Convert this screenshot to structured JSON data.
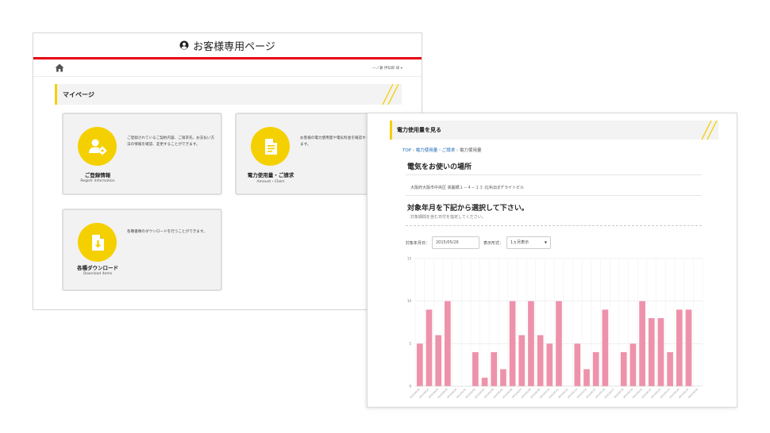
{
  "back_window": {
    "header_title": "お客様専用ページ",
    "user_menu": "一ノ瀬 伊知郎 様 ▾",
    "section_title": "マイページ",
    "cards": [
      {
        "title": "ご登録情報",
        "subtitle": "Registr Information",
        "description": "ご登録されているご契約内容、ご請求先、お支払い方法の情報を確認、変更することができます。",
        "icon": "user-gear-icon"
      },
      {
        "title": "電力使用量・ご請求",
        "subtitle": "Amount・Claim",
        "description": "お客様の電力使用量や電気料金を確認することができます。",
        "icon": "document-icon"
      },
      {
        "title": "各種ダウンロード",
        "subtitle": "Download items",
        "description": "各種書類のダウンロードを行うことができます。",
        "icon": "download-file-icon"
      }
    ]
  },
  "front_window": {
    "section_title": "電力使用量を見る",
    "breadcrumb": [
      "TOP",
      "電力使用量・ご請求",
      "電力使用量"
    ],
    "breadcrumb_sep": "›",
    "place_heading": "電気をお使いの場所",
    "address": "大阪府大阪市中央区 高麗橋１－４－１３ 北浜ほぼデライトビル",
    "period_heading": "対象年月を下記から選択して下さい。",
    "period_note": "対象期間を含む日付を指定してください。",
    "filter": {
      "date_label": "対象年月日：",
      "date_value": "2015/05/26",
      "display_label": "表示形式：",
      "display_value": "1ヵ月表示"
    }
  },
  "colors": {
    "accent_yellow": "#f5d000",
    "header_red": "#e60012",
    "bar_pink": "#ee92ab"
  },
  "chart_data": {
    "type": "bar",
    "title": "",
    "xlabel": "",
    "ylabel": "",
    "ylim": [
      0,
      15
    ],
    "yticks": [
      "0",
      "5",
      "10",
      "15"
    ],
    "grid": true,
    "categories": [
      "2015/04/26",
      "2015/04/27",
      "2015/04/28",
      "2015/04/29",
      "2015/04/30",
      "2015/05/01",
      "2015/05/02",
      "2015/05/03",
      "2015/05/04",
      "2015/05/05",
      "2015/05/06",
      "2015/05/07",
      "2015/05/08",
      "2015/05/09",
      "2015/05/10",
      "2015/05/11",
      "2015/05/12",
      "2015/05/13",
      "2015/05/14",
      "2015/05/15",
      "2015/05/16",
      "2015/05/17",
      "2015/05/18",
      "2015/05/19",
      "2015/05/20",
      "2015/05/21",
      "2015/05/22",
      "2015/05/23",
      "2015/05/24",
      "2015/05/25",
      "2015/05/26"
    ],
    "values": [
      5,
      9,
      6,
      10,
      0,
      0,
      4,
      1,
      4,
      2,
      10,
      6,
      10,
      6,
      5,
      10,
      0,
      5,
      2,
      4,
      9,
      0,
      4,
      5,
      10,
      8,
      8,
      4,
      9,
      9,
      0
    ]
  }
}
